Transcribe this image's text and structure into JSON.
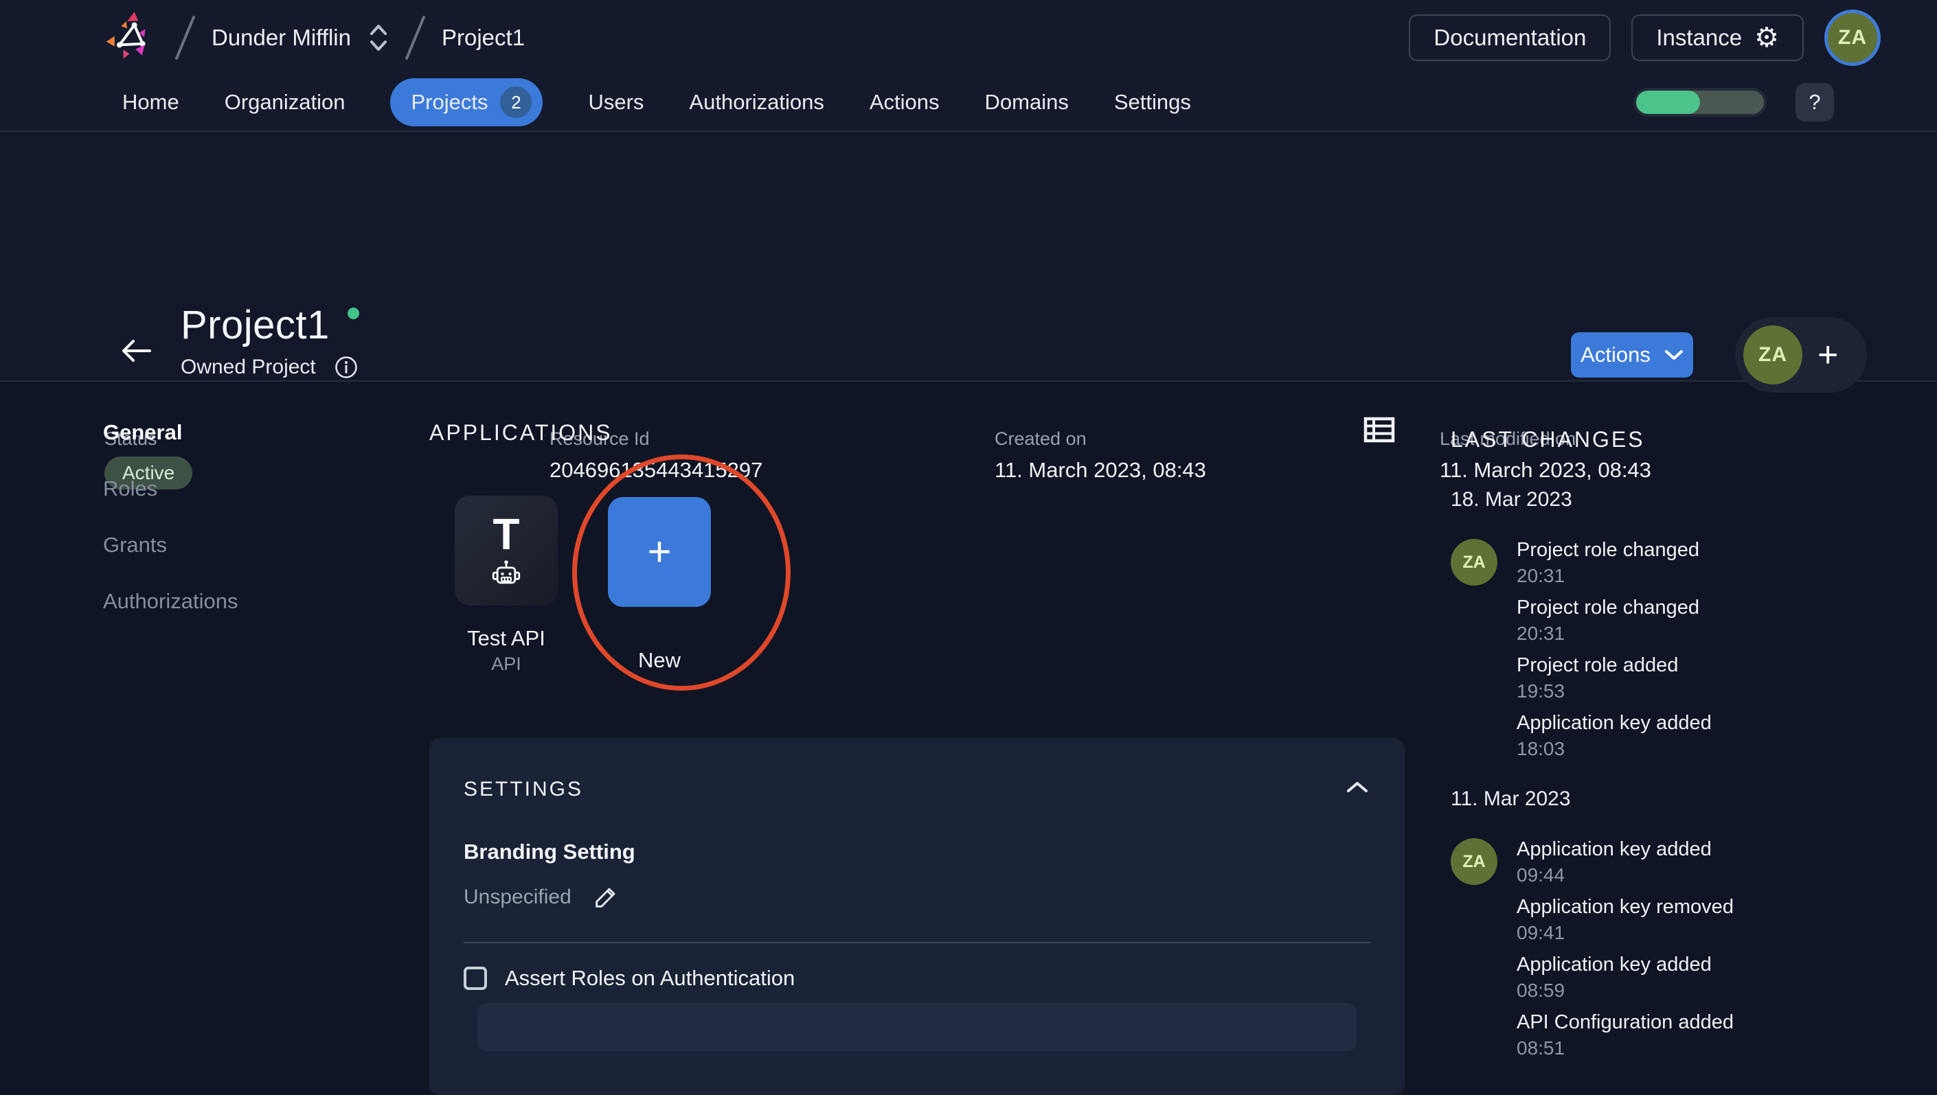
{
  "topbar": {
    "org": "Dunder Mifflin",
    "project_breadcrumb": "Project1",
    "documentation_label": "Documentation",
    "instance_label": "Instance",
    "avatar_initials": "ZA"
  },
  "nav": {
    "items": [
      {
        "label": "Home"
      },
      {
        "label": "Organization"
      },
      {
        "label": "Projects",
        "badge": "2",
        "active": true
      },
      {
        "label": "Users"
      },
      {
        "label": "Authorizations"
      },
      {
        "label": "Actions"
      },
      {
        "label": "Domains"
      },
      {
        "label": "Settings"
      }
    ],
    "help": "?"
  },
  "progress": {
    "percent": 50
  },
  "header": {
    "title": "Project1",
    "subtitle": "Owned Project",
    "actions_label": "Actions",
    "avatar_initials": "ZA"
  },
  "meta": {
    "status_label": "Status",
    "status_value": "Active",
    "resource_label": "Resource Id",
    "resource_value": "204696135443415297",
    "created_label": "Created on",
    "created_value": "11. March 2023, 08:43",
    "modified_label": "Last modified on",
    "modified_value": "11. March 2023, 08:43"
  },
  "sidebar": {
    "items": [
      {
        "label": "General",
        "active": true
      },
      {
        "label": "Roles"
      },
      {
        "label": "Grants"
      },
      {
        "label": "Authorizations"
      }
    ]
  },
  "applications": {
    "title": "APPLICATIONS",
    "apps": [
      {
        "initial": "T",
        "name": "Test API",
        "type": "API"
      },
      {
        "name": "New"
      }
    ]
  },
  "settings_card": {
    "title": "SETTINGS",
    "branding_label": "Branding Setting",
    "branding_value": "Unspecified",
    "checkbox_label": "Assert Roles on Authentication",
    "checked": false
  },
  "last_changes": {
    "title": "LAST CHANGES",
    "groups": [
      {
        "date": "18. Mar 2023",
        "avatar": "ZA",
        "events": [
          {
            "text": "Project role changed",
            "time": "20:31"
          },
          {
            "text": "Project role changed",
            "time": "20:31"
          },
          {
            "text": "Project role added",
            "time": "19:53"
          },
          {
            "text": "Application key added",
            "time": "18:03"
          }
        ]
      },
      {
        "date": "11. Mar 2023",
        "avatar": "ZA",
        "events": [
          {
            "text": "Application key added",
            "time": "09:44"
          },
          {
            "text": "Application key removed",
            "time": "09:41"
          },
          {
            "text": "Application key added",
            "time": "08:59"
          },
          {
            "text": "API Configuration added",
            "time": "08:51"
          }
        ]
      }
    ]
  },
  "icons": {
    "plus": "+",
    "gear": "⚙"
  },
  "colors": {
    "accent_blue": "#3c7ad9",
    "success_green": "#4cc38a",
    "annotation_orange": "#e0482b",
    "avatar_olive": "#5f7134",
    "active_badge_bg": "#3e5145",
    "active_badge_text": "#d7ecd3"
  }
}
